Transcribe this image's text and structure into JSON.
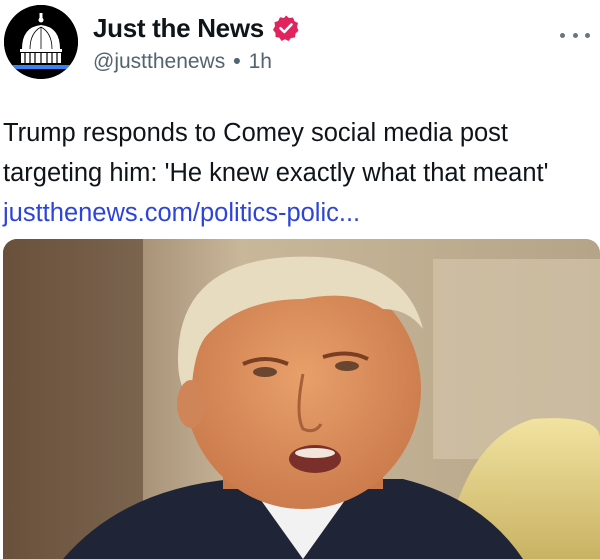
{
  "account": {
    "name": "Just the News",
    "handle": "@justthenews",
    "separator": "•",
    "time": "1h",
    "verified": true,
    "avatar_icon": "capitol-dome-logo"
  },
  "post": {
    "text": "Trump responds to Comey social media post targeting him: 'He knew exactly what that meant'",
    "link": "justthenews.com/politics-polic..."
  },
  "media": {
    "description_icon": "photo"
  },
  "colors": {
    "link": "#2d44d9",
    "verified_badge": "#e0245e",
    "muted_text": "#536471"
  },
  "more_menu_icon": "more-horizontal-icon"
}
